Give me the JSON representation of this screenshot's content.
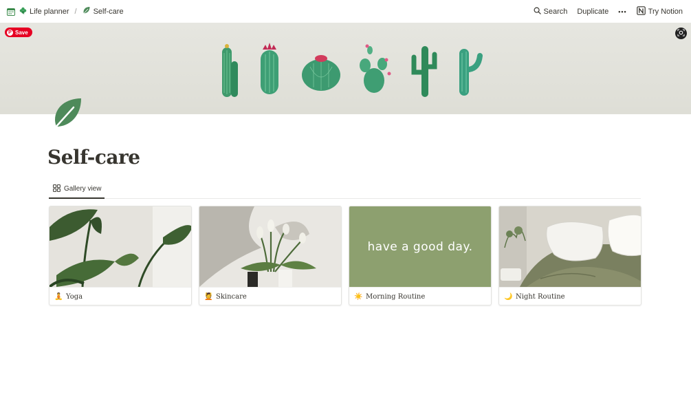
{
  "breadcrumb": {
    "items": [
      {
        "label": "Life planner",
        "icon": "clover-icon"
      },
      {
        "label": "Self-care",
        "icon": "leaf-icon"
      }
    ],
    "separator": "/"
  },
  "topbar": {
    "search_label": "Search",
    "duplicate_label": "Duplicate",
    "more_label": "•••",
    "try_notion_label": "Try Notion"
  },
  "cover": {
    "save_label": "Save"
  },
  "page": {
    "title": "Self-care"
  },
  "views": {
    "active_label": "Gallery view"
  },
  "gallery": {
    "cards": [
      {
        "title": "Yoga",
        "emoji": "🧘"
      },
      {
        "title": "Skincare",
        "emoji": "💆"
      },
      {
        "title": "Morning Routine",
        "emoji": "☀️",
        "cover_text": "have a good day."
      },
      {
        "title": "Night Routine",
        "emoji": "🌙"
      }
    ]
  },
  "colors": {
    "accent_green": "#4e8a5a",
    "card_sage": "#8da06f",
    "pinterest_red": "#e60023"
  }
}
